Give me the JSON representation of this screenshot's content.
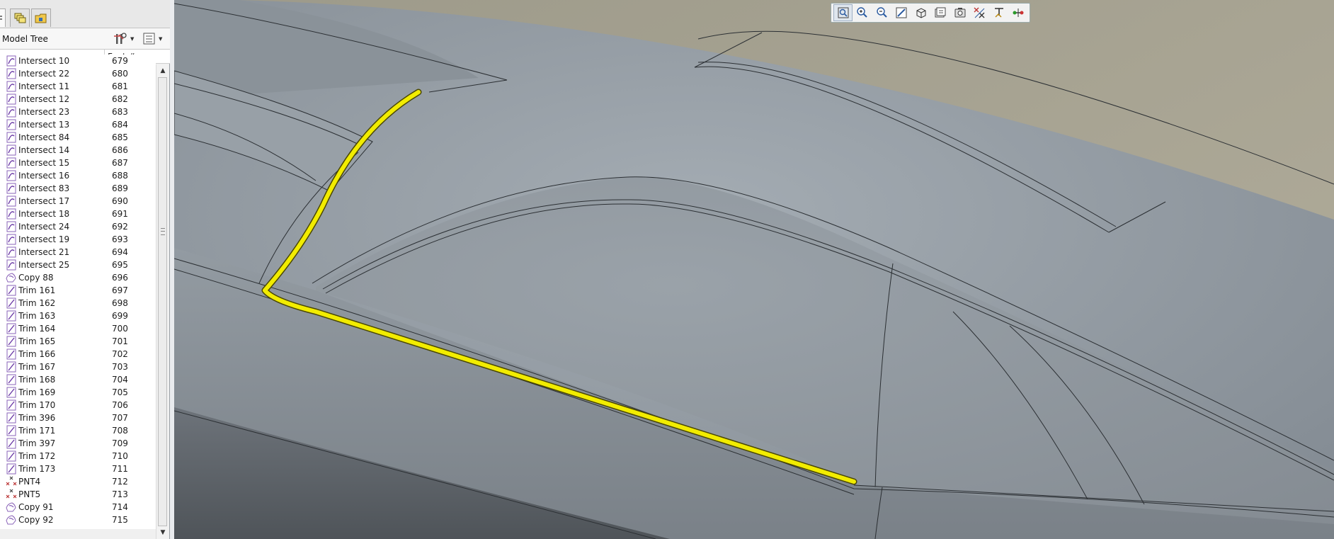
{
  "panel": {
    "tree_title": "Model Tree",
    "column_feat": "Feat #",
    "tab_icons": [
      "model-tree-tab-icon",
      "layers-tab-icon",
      "folder-tab-icon"
    ],
    "settings_icon": "tree-settings-icon",
    "columns_icon": "tree-columns-icon"
  },
  "features": [
    {
      "name": "Intersect 10",
      "num": "679",
      "icon": "intersect-icon"
    },
    {
      "name": "Intersect 22",
      "num": "680",
      "icon": "intersect-icon"
    },
    {
      "name": "Intersect 11",
      "num": "681",
      "icon": "intersect-icon"
    },
    {
      "name": "Intersect 12",
      "num": "682",
      "icon": "intersect-icon"
    },
    {
      "name": "Intersect 23",
      "num": "683",
      "icon": "intersect-icon"
    },
    {
      "name": "Intersect 13",
      "num": "684",
      "icon": "intersect-icon"
    },
    {
      "name": "Intersect 84",
      "num": "685",
      "icon": "intersect-icon"
    },
    {
      "name": "Intersect 14",
      "num": "686",
      "icon": "intersect-icon"
    },
    {
      "name": "Intersect 15",
      "num": "687",
      "icon": "intersect-icon"
    },
    {
      "name": "Intersect 16",
      "num": "688",
      "icon": "intersect-icon"
    },
    {
      "name": "Intersect 83",
      "num": "689",
      "icon": "intersect-icon"
    },
    {
      "name": "Intersect 17",
      "num": "690",
      "icon": "intersect-icon"
    },
    {
      "name": "Intersect 18",
      "num": "691",
      "icon": "intersect-icon"
    },
    {
      "name": "Intersect 24",
      "num": "692",
      "icon": "intersect-icon"
    },
    {
      "name": "Intersect 19",
      "num": "693",
      "icon": "intersect-icon"
    },
    {
      "name": "Intersect 21",
      "num": "694",
      "icon": "intersect-icon"
    },
    {
      "name": "Intersect 25",
      "num": "695",
      "icon": "intersect-icon"
    },
    {
      "name": "Copy 88",
      "num": "696",
      "icon": "copy-icon"
    },
    {
      "name": "Trim 161",
      "num": "697",
      "icon": "trim-icon"
    },
    {
      "name": "Trim 162",
      "num": "698",
      "icon": "trim-icon"
    },
    {
      "name": "Trim 163",
      "num": "699",
      "icon": "trim-icon"
    },
    {
      "name": "Trim 164",
      "num": "700",
      "icon": "trim-icon"
    },
    {
      "name": "Trim 165",
      "num": "701",
      "icon": "trim-icon"
    },
    {
      "name": "Trim 166",
      "num": "702",
      "icon": "trim-icon"
    },
    {
      "name": "Trim 167",
      "num": "703",
      "icon": "trim-icon"
    },
    {
      "name": "Trim 168",
      "num": "704",
      "icon": "trim-icon"
    },
    {
      "name": "Trim 169",
      "num": "705",
      "icon": "trim-icon"
    },
    {
      "name": "Trim 170",
      "num": "706",
      "icon": "trim-icon"
    },
    {
      "name": "Trim 396",
      "num": "707",
      "icon": "trim-icon"
    },
    {
      "name": "Trim 171",
      "num": "708",
      "icon": "trim-icon"
    },
    {
      "name": "Trim 397",
      "num": "709",
      "icon": "trim-icon"
    },
    {
      "name": "Trim 172",
      "num": "710",
      "icon": "trim-icon"
    },
    {
      "name": "Trim 173",
      "num": "711",
      "icon": "trim-icon"
    },
    {
      "name": "PNT4",
      "num": "712",
      "icon": "datum-point-icon"
    },
    {
      "name": "PNT5",
      "num": "713",
      "icon": "datum-point-icon"
    },
    {
      "name": "Copy 91",
      "num": "714",
      "icon": "copy-icon"
    },
    {
      "name": "Copy 92",
      "num": "715",
      "icon": "copy-icon"
    }
  ],
  "toolbar": {
    "buttons": [
      {
        "icon": "refit-icon"
      },
      {
        "icon": "zoom-in-icon"
      },
      {
        "icon": "zoom-out-icon"
      },
      {
        "icon": "repaint-icon"
      },
      {
        "icon": "display-style-icon"
      },
      {
        "icon": "saved-views-icon"
      },
      {
        "icon": "view-manager-icon"
      },
      {
        "icon": "datum-display-icon"
      },
      {
        "icon": "annotation-display-icon"
      },
      {
        "icon": "spin-center-icon"
      }
    ]
  },
  "colors": {
    "highlight": "#f2ec00",
    "surface": "#8e969d",
    "background": "#a29e8e"
  }
}
